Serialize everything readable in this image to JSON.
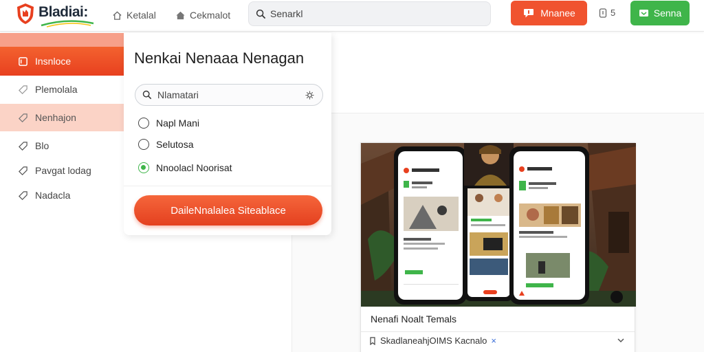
{
  "header": {
    "logo_text": "Bladiai:",
    "nav": [
      {
        "label": "Ketalal",
        "icon": "house-outline-icon"
      },
      {
        "label": "Cekmalot",
        "icon": "house-filled-icon"
      }
    ],
    "search_value": "Senarkl",
    "primary_button": "Mnanee",
    "notification_count": "5",
    "secondary_button": "Senna"
  },
  "sidebar": {
    "items": [
      {
        "label": "Insnloce",
        "icon": "square-icon"
      },
      {
        "label": "Plemolala",
        "icon": "tag-icon"
      },
      {
        "label": "Nenhajon",
        "icon": "tag-icon"
      },
      {
        "label": "Blo",
        "icon": "tag-icon"
      },
      {
        "label": "Pavgat lodag",
        "icon": "tag-icon"
      },
      {
        "label": "Nadacla",
        "icon": "tag-icon"
      }
    ]
  },
  "panel": {
    "title": "Nenkai Nenaaa Nenagan",
    "search_value": "Nlamatari",
    "options": [
      {
        "label": "Napl Mani",
        "checked": false
      },
      {
        "label": "Selutosa",
        "checked": false
      },
      {
        "label": "Nnoolacl Noorisat",
        "checked": true
      }
    ],
    "cta_label": "DaileNnalalea Siteablace"
  },
  "card": {
    "title": "Nenafi Noalt Temals",
    "meta_text": "SkadlaneahjOIMS Kacnalo",
    "meta_close": "×"
  },
  "colors": {
    "accent_red": "#f0532f",
    "accent_green": "#3fb54a"
  }
}
